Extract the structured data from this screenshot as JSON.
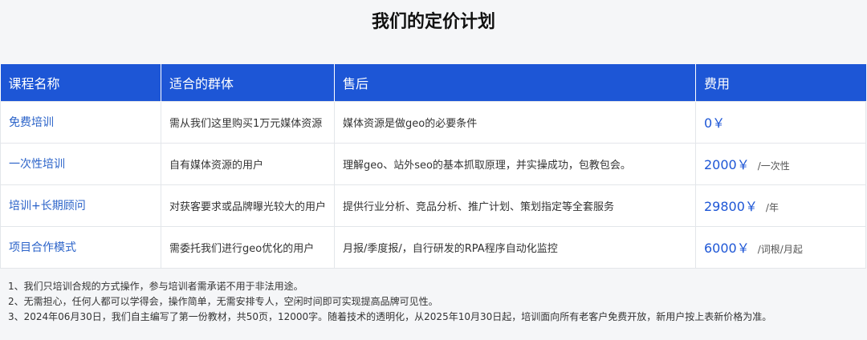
{
  "title": "我们的定价计划",
  "table": {
    "headers": [
      "课程名称",
      "适合的群体",
      "售后",
      "费用"
    ],
    "rows": [
      {
        "course": "免费培训",
        "audience": "需从我们这里购买1万元媒体资源",
        "service": "媒体资源是做geo的必要条件",
        "price": "0￥",
        "unit": ""
      },
      {
        "course": "一次性培训",
        "audience": "自有媒体资源的用户",
        "service": "理解geo、站外seo的基本抓取原理，并实操成功，包教包会。",
        "price": "2000￥",
        "unit": "/一次性"
      },
      {
        "course": "培训+长期顾问",
        "audience": "对获客要求或品牌曝光较大的用户",
        "service": "提供行业分析、竞品分析、推广计划、策划指定等全套服务",
        "price": "29800￥",
        "unit": "/年"
      },
      {
        "course": "项目合作模式",
        "audience": "需委托我们进行geo优化的用户",
        "service": "月报/季度报/，自行研发的RPA程序自动化监控",
        "price": "6000￥",
        "unit": "/词根/月起"
      }
    ]
  },
  "notes": [
    "1、我们只培训合规的方式操作，参与培训者需承诺不用于非法用途。",
    "2、无需担心，任何人都可以学得会，操作简单，无需安排专人，空闲时间即可实现提高品牌可见性。",
    "3、2024年06月30日，我们自主编写了第一份教材，共50页，12000字。随着技术的透明化，从2025年10月30日起，培训面向所有老客户免费开放，新用户按上表新价格为准。"
  ],
  "colors": {
    "header_bg": "#1d56d6",
    "accent_text": "#2b63c9"
  }
}
